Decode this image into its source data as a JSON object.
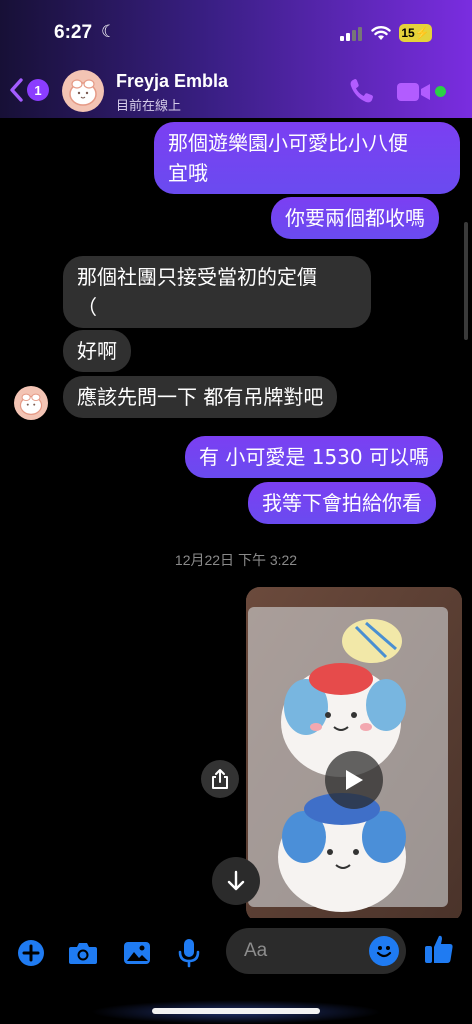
{
  "status_bar": {
    "time": "6:27",
    "battery": "15"
  },
  "header": {
    "back_badge": "1",
    "contact_name": "Freyja Embla",
    "contact_status": "目前在線上"
  },
  "messages": [
    {
      "direction": "outgoing",
      "text": "那個遊樂園小可愛比小八便\n宜哦"
    },
    {
      "direction": "outgoing",
      "text": "你要兩個都收嗎"
    },
    {
      "direction": "incoming",
      "text": "那個社團只接受當初的定價\n（"
    },
    {
      "direction": "incoming",
      "text": "好啊"
    },
    {
      "direction": "incoming",
      "text": "應該先問一下 都有吊牌對吧"
    },
    {
      "direction": "outgoing",
      "text": "有 小可愛是 1530 可以嗎"
    },
    {
      "direction": "outgoing",
      "text": "我等下會拍給你看"
    }
  ],
  "date_separator": "12月22日 下午 3:22",
  "composer": {
    "placeholder": "Aa"
  },
  "icons": {
    "back": "chevron-left-icon",
    "call": "phone-icon",
    "video": "video-camera-icon",
    "add": "plus-circle-icon",
    "camera": "camera-icon",
    "gallery": "image-icon",
    "mic": "microphone-icon",
    "emoji": "smiley-icon",
    "like": "thumbs-up-icon",
    "share": "share-icon",
    "play": "play-icon",
    "scroll_down": "arrow-down-icon"
  },
  "colors": {
    "accent": "#8b3dff",
    "outgoing_bubble": "#7346f2",
    "incoming_bubble": "#303030",
    "toolbar_icon": "#1f7bf2",
    "online": "#2bd046"
  }
}
